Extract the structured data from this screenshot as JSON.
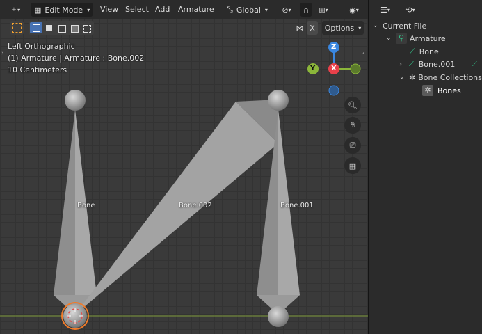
{
  "header": {
    "mode_label": "Edit Mode",
    "menus": [
      "View",
      "Select",
      "Add",
      "Armature"
    ],
    "orientation_label": "Global",
    "options_label": "Options",
    "x_label": "X"
  },
  "overlay": {
    "view_name": "Left Orthographic",
    "context": "(1) Armature | Armature : Bone.002",
    "scale": "10 Centimeters"
  },
  "gizmo": {
    "z": "Z",
    "y": "Y",
    "x": "X"
  },
  "bones": [
    {
      "name": "Bone"
    },
    {
      "name": "Bone.002"
    },
    {
      "name": "Bone.001"
    }
  ],
  "outliner": {
    "root": "Current File",
    "armature": "Armature",
    "bone": "Bone",
    "bone001": "Bone.001",
    "collections": "Bone Collections",
    "bones_collection": "Bones"
  },
  "colors": {
    "accent_bone": "#33c28a",
    "axis_x": "#e8404a",
    "axis_y": "#8bb63a",
    "axis_z": "#3a87e0",
    "select_orange": "#f07b2a"
  }
}
